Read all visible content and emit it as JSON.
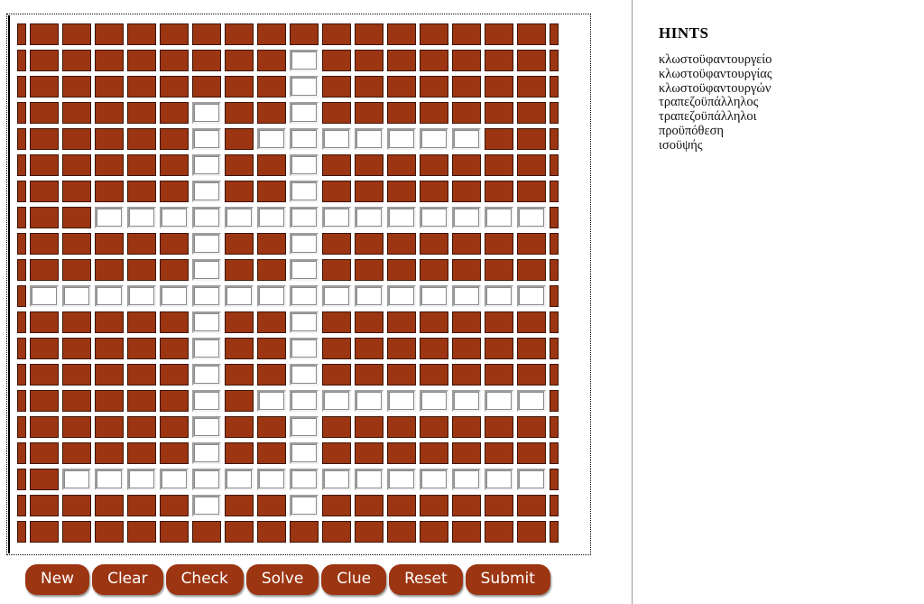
{
  "hints": {
    "title": "HINTS",
    "words": [
      "κλωστοϋφαντουργείο",
      "κλωστοϋφαντουργίας",
      "κλωστοϋφαντουργών",
      "τραπεζοϋπάλληλος",
      "τραπεζοϋπάλληλοι",
      "προϋπόθεση",
      "ισοϋψής"
    ]
  },
  "buttons": [
    {
      "label": "New",
      "name": "new-button"
    },
    {
      "label": "Clear",
      "name": "clear-button"
    },
    {
      "label": "Check",
      "name": "check-button"
    },
    {
      "label": "Solve",
      "name": "solve-button"
    },
    {
      "label": "Clue",
      "name": "clue-button"
    },
    {
      "label": "Reset",
      "name": "reset-button"
    },
    {
      "label": "Submit",
      "name": "submit-button"
    }
  ],
  "colors": {
    "block": "#9c3512",
    "open": "#ffffff",
    "button": "#9c3512",
    "button_text": "#ffffff",
    "divider": "#9a9a9a"
  },
  "grid": {
    "columns": 18,
    "rows": 20,
    "legend": {
      "0": "block",
      "1": "open"
    },
    "cells": [
      [
        0,
        0,
        0,
        0,
        0,
        0,
        0,
        0,
        0,
        0,
        0,
        0,
        0,
        0,
        0,
        0,
        0,
        0
      ],
      [
        0,
        0,
        0,
        0,
        0,
        0,
        0,
        0,
        0,
        1,
        0,
        0,
        0,
        0,
        0,
        0,
        0,
        0
      ],
      [
        0,
        0,
        0,
        0,
        0,
        0,
        0,
        0,
        0,
        1,
        0,
        0,
        0,
        0,
        0,
        0,
        0,
        0
      ],
      [
        0,
        0,
        0,
        0,
        0,
        0,
        1,
        0,
        0,
        1,
        0,
        0,
        0,
        0,
        0,
        0,
        0,
        0
      ],
      [
        0,
        0,
        0,
        0,
        0,
        0,
        1,
        0,
        1,
        1,
        1,
        1,
        1,
        1,
        1,
        0,
        0,
        0
      ],
      [
        0,
        0,
        0,
        0,
        0,
        0,
        1,
        0,
        0,
        1,
        0,
        0,
        0,
        0,
        0,
        0,
        0,
        0
      ],
      [
        0,
        0,
        0,
        0,
        0,
        0,
        1,
        0,
        0,
        1,
        0,
        0,
        0,
        0,
        0,
        0,
        0,
        0
      ],
      [
        0,
        0,
        0,
        1,
        1,
        1,
        1,
        1,
        1,
        1,
        1,
        1,
        1,
        1,
        1,
        1,
        1,
        0
      ],
      [
        0,
        0,
        0,
        0,
        0,
        0,
        1,
        0,
        0,
        1,
        0,
        0,
        0,
        0,
        0,
        0,
        0,
        0
      ],
      [
        0,
        0,
        0,
        0,
        0,
        0,
        1,
        0,
        0,
        1,
        0,
        0,
        0,
        0,
        0,
        0,
        0,
        0
      ],
      [
        0,
        1,
        1,
        1,
        1,
        1,
        1,
        1,
        1,
        1,
        1,
        1,
        1,
        1,
        1,
        1,
        1,
        0
      ],
      [
        0,
        0,
        0,
        0,
        0,
        0,
        1,
        0,
        0,
        1,
        0,
        0,
        0,
        0,
        0,
        0,
        0,
        0
      ],
      [
        0,
        0,
        0,
        0,
        0,
        0,
        1,
        0,
        0,
        1,
        0,
        0,
        0,
        0,
        0,
        0,
        0,
        0
      ],
      [
        0,
        0,
        0,
        0,
        0,
        0,
        1,
        0,
        0,
        1,
        0,
        0,
        0,
        0,
        0,
        0,
        0,
        0
      ],
      [
        0,
        0,
        0,
        0,
        0,
        0,
        1,
        0,
        1,
        1,
        1,
        1,
        1,
        1,
        1,
        1,
        1,
        0
      ],
      [
        0,
        0,
        0,
        0,
        0,
        0,
        1,
        0,
        0,
        1,
        0,
        0,
        0,
        0,
        0,
        0,
        0,
        0
      ],
      [
        0,
        0,
        0,
        0,
        0,
        0,
        1,
        0,
        0,
        1,
        0,
        0,
        0,
        0,
        0,
        0,
        0,
        0
      ],
      [
        0,
        0,
        1,
        1,
        1,
        1,
        1,
        1,
        1,
        1,
        1,
        1,
        1,
        1,
        1,
        1,
        1,
        0
      ],
      [
        0,
        0,
        0,
        0,
        0,
        0,
        1,
        0,
        0,
        1,
        0,
        0,
        0,
        0,
        0,
        0,
        0,
        0
      ],
      [
        0,
        0,
        0,
        0,
        0,
        0,
        0,
        0,
        0,
        0,
        0,
        0,
        0,
        0,
        0,
        0,
        0,
        0
      ]
    ]
  }
}
